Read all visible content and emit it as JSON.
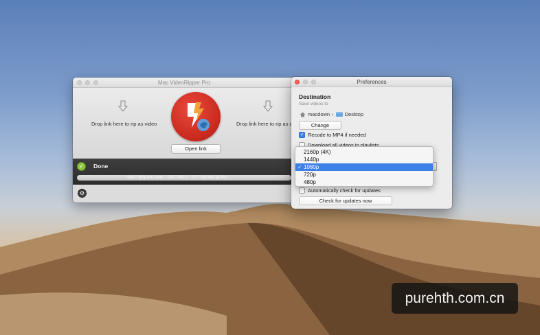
{
  "main_window": {
    "title": "Mac VideoRipper Pro",
    "drop_left": "Drop link here to rip as video",
    "drop_right": "Drop link here to rip as a",
    "open_link": "Open link",
    "status": "Done",
    "progress_url": "https://gfspace.com/…/20170411/…/2172/gorilla.gif.mp…",
    "progress_fraction": 1.0
  },
  "preferences": {
    "title": "Preferences",
    "destination_title": "Destination",
    "destination_sub": "Save videos to",
    "path_home": "macdown",
    "path_separator": "›",
    "path_folder": "Desktop",
    "change_button": "Change",
    "recode_label": "Recode to MP4 if needed",
    "recode_checked": true,
    "playlists_label": "Download all videos in playlists",
    "auto_update_label": "Automatically check for updates",
    "check_updates_button": "Check for updates now"
  },
  "quality_dropdown": {
    "options": [
      "2160p (4K)",
      "1440p",
      "1080p",
      "720p",
      "480p"
    ],
    "selected": "1080p",
    "checkmark": "✓"
  },
  "watermark": "purehth.com.cn",
  "colors": {
    "accent_blue": "#3c7fe6",
    "logo_red": "#c8281d",
    "done_green": "#8bc53f"
  }
}
